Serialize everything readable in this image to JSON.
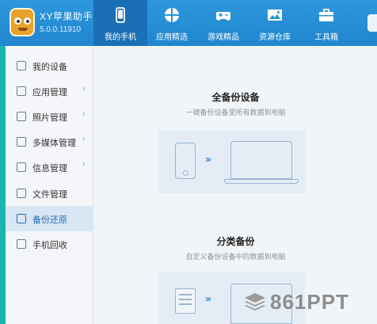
{
  "app": {
    "title": "XY苹果助手",
    "version": "5.0.0.11910"
  },
  "nav": [
    {
      "label": "我的手机",
      "icon": "phone-icon",
      "active": true
    },
    {
      "label": "应用精选",
      "icon": "apps-icon",
      "active": false
    },
    {
      "label": "游戏精品",
      "icon": "gamepad-icon",
      "active": false
    },
    {
      "label": "资源仓库",
      "icon": "image-icon",
      "active": false
    },
    {
      "label": "工具箱",
      "icon": "toolbox-icon",
      "active": false
    }
  ],
  "sidebar": {
    "items": [
      {
        "label": "我的设备",
        "icon": "device-icon",
        "chevron": false
      },
      {
        "label": "应用管理",
        "icon": "grid-icon",
        "chevron": true
      },
      {
        "label": "照片管理",
        "icon": "photo-icon",
        "chevron": true
      },
      {
        "label": "多媒体管理",
        "icon": "media-icon",
        "chevron": true
      },
      {
        "label": "信息管理",
        "icon": "message-icon",
        "chevron": true
      },
      {
        "label": "文件管理",
        "icon": "folder-icon",
        "chevron": false
      },
      {
        "label": "备份还原",
        "icon": "backup-icon",
        "chevron": false,
        "active": true
      },
      {
        "label": "手机回收",
        "icon": "recycle-icon",
        "chevron": false
      }
    ],
    "chevron_glyph": "›"
  },
  "main": {
    "full_backup": {
      "title": "全备份设备",
      "subtitle": "一键备份设备里所有数据到电脑"
    },
    "category_backup": {
      "title": "分类备份",
      "subtitle": "自定义备份设备中的数据到电脑"
    },
    "arrow_glyph": "›››"
  },
  "watermark": {
    "text": "861PPT"
  },
  "colors": {
    "header": "#2396dc",
    "nav_active": "#1b6fb4",
    "sidebar_stripe": "#18b6b0",
    "sidebar_active": "#d9e6f3",
    "accent": "#1f6fb8"
  }
}
